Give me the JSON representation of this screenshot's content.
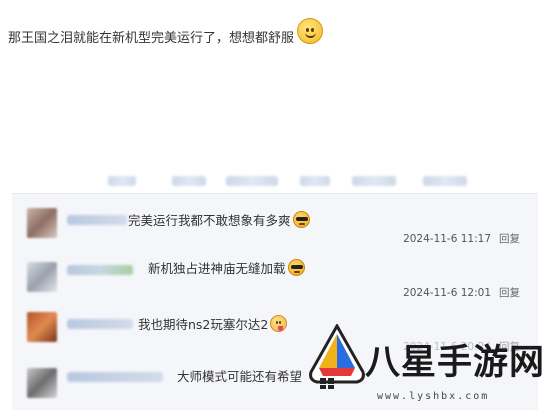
{
  "post": {
    "text": "那王国之泪就能在新机型完美运行了，想想都舒服",
    "emoji": "smile-emoji-icon"
  },
  "comments": [
    {
      "text": "完美运行我都不敢想象有多爽",
      "emoji": "cool-sunglasses-emoji-icon",
      "time": "2024-11-6 11:17",
      "reply": "回复"
    },
    {
      "text": "新机独占进神庙无缝加载",
      "emoji": "cool-sunglasses-emoji-icon",
      "time": "2024-11-6 12:01",
      "reply": "回复"
    },
    {
      "text": "我也期待ns2玩塞尔达2",
      "emoji": "tongue-out-emoji-icon",
      "time": "2024-11-6 20:24",
      "reply": "回复"
    },
    {
      "text": "大师模式可能还有希望",
      "emoji": ""
    }
  ],
  "watermark": {
    "title": "八星手游网",
    "url": "www.lyshbx.com"
  }
}
